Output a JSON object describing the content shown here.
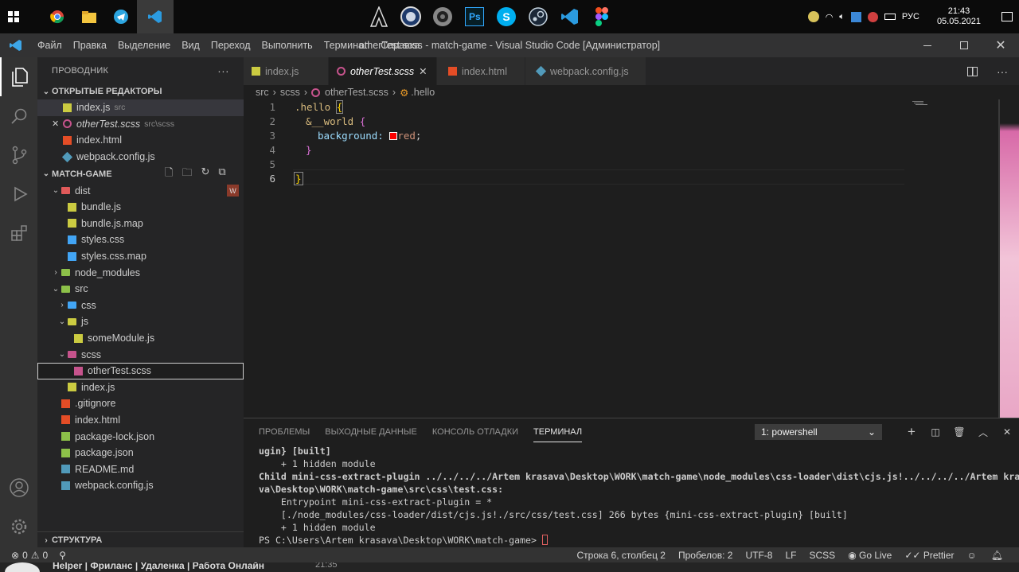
{
  "taskbar": {
    "clock_time": "21:43",
    "clock_date": "05.05.2021",
    "lang": "РУС"
  },
  "window": {
    "title": "otherTest.scss - match-game - Visual Studio Code [Администратор]",
    "menu": [
      "Файл",
      "Правка",
      "Выделение",
      "Вид",
      "Переход",
      "Выполнить",
      "Терминал",
      "Справка"
    ]
  },
  "sidebar": {
    "header": "ПРОВОДНИК",
    "more": "···",
    "open_editors_label": "ОТКРЫТЫЕ РЕДАКТОРЫ",
    "open_editors": [
      {
        "name": "index.js",
        "sub": "src"
      },
      {
        "name": "otherTest.scss",
        "sub": "src\\scss"
      },
      {
        "name": "index.html",
        "sub": ""
      },
      {
        "name": "webpack.config.js",
        "sub": ""
      }
    ],
    "project_label": "MATCH-GAME",
    "badge": "W",
    "tree": [
      "dist",
      "bundle.js",
      "bundle.js.map",
      "styles.css",
      "styles.css.map",
      "node_modules",
      "src",
      "css",
      "js",
      "someModule.js",
      "scss",
      "otherTest.scss",
      "index.js",
      ".gitignore",
      "index.html",
      "package-lock.json",
      "package.json",
      "README.md",
      "webpack.config.js"
    ],
    "outline_label": "СТРУКТУРА"
  },
  "tabs": [
    "index.js",
    "otherTest.scss",
    "index.html",
    "webpack.config.js"
  ],
  "breadcrumb": [
    "src",
    "scss",
    "otherTest.scss",
    ".hello"
  ],
  "editor": {
    "line_numbers": [
      "1",
      "2",
      "3",
      "4",
      "5",
      "6"
    ],
    "lines": {
      "l1a": ".hello",
      "l1b": "{",
      "l2a": "&__world",
      "l2b": "{",
      "l3a": "background:",
      "l3b": "red",
      ";": ";",
      "l4": "}",
      "l6": "}"
    }
  },
  "panel": {
    "tabs": [
      "ПРОБЛЕМЫ",
      "ВЫХОДНЫЕ ДАННЫЕ",
      "КОНСОЛЬ ОТЛАДКИ",
      "ТЕРМИНАЛ"
    ],
    "terminal_select": "1: powershell",
    "lines": [
      "ugin} [built]",
      "    + 1 hidden module",
      "Child mini-css-extract-plugin ../../../../Artem krasava\\Desktop\\WORK\\match-game\\node_modules\\css-loader\\dist\\cjs.js!../../../../Artem krasa",
      "va\\Desktop\\WORK\\match-game\\src\\css\\test.css:",
      "    Entrypoint mini-css-extract-plugin = *",
      "    [./node_modules/css-loader/dist/cjs.js!./src/css/test.css] 266 bytes {mini-css-extract-plugin} [built]",
      "    + 1 hidden module",
      "PS C:\\Users\\Artem krasava\\Desktop\\WORK\\match-game> "
    ]
  },
  "status": {
    "errors": "0",
    "warnings": "0",
    "position": "Строка 6, столбец 2",
    "spaces": "Пробелов: 2",
    "encoding": "UTF-8",
    "eol": "LF",
    "lang": "SCSS",
    "golive": "Go Live",
    "prettier": "Prettier"
  },
  "bottom": {
    "text": "Helper | Фриланс | Удаленка | Работа Онлайн",
    "time": "21:35"
  },
  "colors": {
    "accent": "#007acc",
    "scss": "#c6538c",
    "js": "#cbcb41",
    "html": "#e44d26",
    "json": "#8dc149",
    "info": "#519aba"
  }
}
